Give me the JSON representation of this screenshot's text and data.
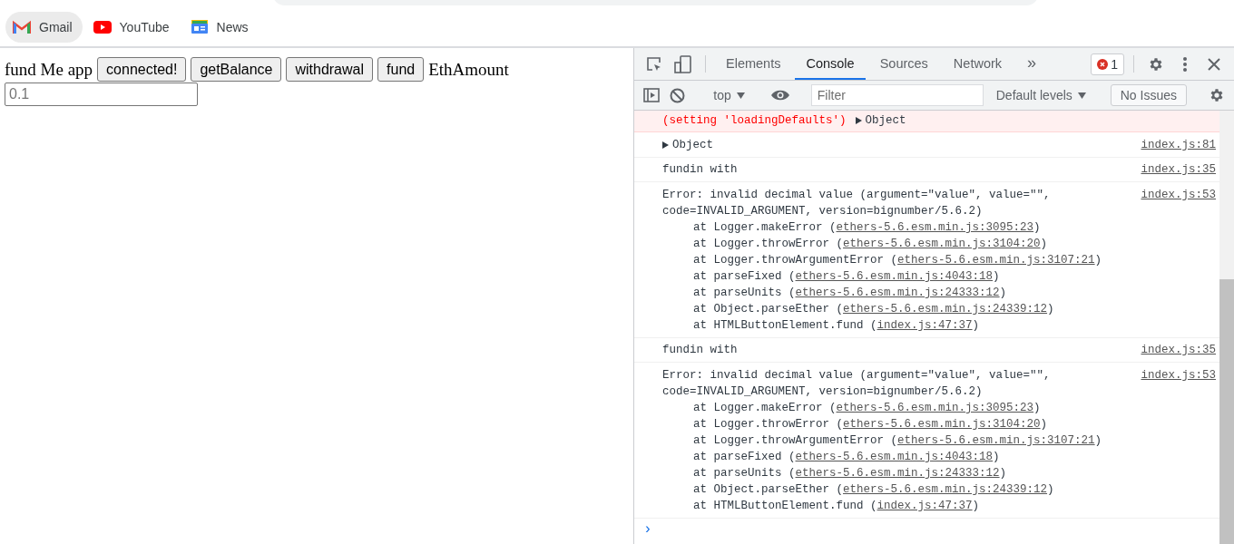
{
  "bookmarks": [
    {
      "label": "Gmail",
      "kind": "gmail",
      "selected": true
    },
    {
      "label": "YouTube",
      "kind": "youtube",
      "selected": false
    },
    {
      "label": "News",
      "kind": "news",
      "selected": false
    }
  ],
  "page": {
    "title": "fund Me app",
    "buttons": [
      "connected!",
      "getBalance",
      "withdrawal",
      "fund"
    ],
    "amount_label": "EthAmount",
    "amount_placeholder": "0.1"
  },
  "devtools": {
    "tabs": [
      {
        "label": "Elements",
        "selected": false
      },
      {
        "label": "Console",
        "selected": true
      },
      {
        "label": "Sources",
        "selected": false
      },
      {
        "label": "Network",
        "selected": false
      }
    ],
    "more": "»",
    "error_count": "1",
    "toolbar": {
      "context": "top",
      "filter_placeholder": "Filter",
      "levels": "Default levels",
      "issues": "No Issues"
    },
    "messages": [
      {
        "kind": "error_tail",
        "text": "(setting 'loadingDefaults')",
        "object": "Object"
      },
      {
        "kind": "object",
        "object": "Object",
        "source": "index.js:81"
      },
      {
        "kind": "log",
        "text": "fundin with",
        "source": "index.js:35"
      },
      {
        "kind": "stack",
        "lines": [
          "Error: invalid decimal value (argument=\"value\", value=\"\",",
          "code=INVALID_ARGUMENT, version=bignumber/5.6.2)"
        ],
        "source": "index.js:53",
        "frames": [
          {
            "text": "at Logger.makeError (",
            "link": "ethers-5.6.esm.min.js:3095:23",
            "end": ")"
          },
          {
            "text": "at Logger.throwError (",
            "link": "ethers-5.6.esm.min.js:3104:20",
            "end": ")"
          },
          {
            "text": "at Logger.throwArgumentError (",
            "link": "ethers-5.6.esm.min.js:3107:21",
            "end": ")"
          },
          {
            "text": "at parseFixed (",
            "link": "ethers-5.6.esm.min.js:4043:18",
            "end": ")"
          },
          {
            "text": "at parseUnits (",
            "link": "ethers-5.6.esm.min.js:24333:12",
            "end": ")"
          },
          {
            "text": "at Object.parseEther (",
            "link": "ethers-5.6.esm.min.js:24339:12",
            "end": ")"
          },
          {
            "text": "at HTMLButtonElement.fund (",
            "link": "index.js:47:37",
            "end": ")"
          }
        ]
      },
      {
        "kind": "log",
        "text": "fundin with",
        "source": "index.js:35"
      },
      {
        "kind": "stack",
        "lines": [
          "Error: invalid decimal value (argument=\"value\", value=\"\",",
          "code=INVALID_ARGUMENT, version=bignumber/5.6.2)"
        ],
        "source": "index.js:53",
        "frames": [
          {
            "text": "at Logger.makeError (",
            "link": "ethers-5.6.esm.min.js:3095:23",
            "end": ")"
          },
          {
            "text": "at Logger.throwError (",
            "link": "ethers-5.6.esm.min.js:3104:20",
            "end": ")"
          },
          {
            "text": "at Logger.throwArgumentError (",
            "link": "ethers-5.6.esm.min.js:3107:21",
            "end": ")"
          },
          {
            "text": "at parseFixed (",
            "link": "ethers-5.6.esm.min.js:4043:18",
            "end": ")"
          },
          {
            "text": "at parseUnits (",
            "link": "ethers-5.6.esm.min.js:24333:12",
            "end": ")"
          },
          {
            "text": "at Object.parseEther (",
            "link": "ethers-5.6.esm.min.js:24339:12",
            "end": ")"
          },
          {
            "text": "at HTMLButtonElement.fund (",
            "link": "index.js:47:37",
            "end": ")"
          }
        ]
      }
    ],
    "prompt": "›"
  }
}
